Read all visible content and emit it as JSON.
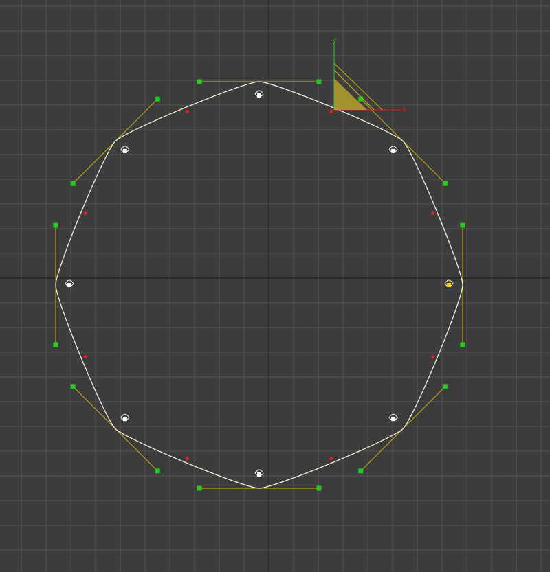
{
  "viewport": {
    "name": "top-orthographic-viewport",
    "colors": {
      "background": "#3c3c3c",
      "grid": "#555555",
      "grid_center": "#1e1e1e",
      "spline": "#f4f0dc",
      "tangent": "#c8b400",
      "tangent_handle": "#22cc22",
      "segment_marker": "#e02020",
      "vertex_marker": "#ffffff",
      "selected_vertex": "#ffd400",
      "gizmo_fill": "#b4a02a",
      "gizmo_x": "#e02020",
      "gizmo_y": "#22cc22"
    }
  },
  "gizmo": {
    "x_label": "x",
    "y_label": "y"
  },
  "spline": {
    "closed": true,
    "vertex_count": 8,
    "selected_vertex_index": 2
  }
}
